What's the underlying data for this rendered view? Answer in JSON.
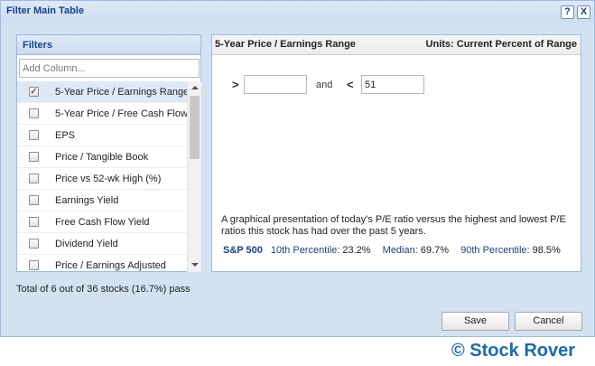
{
  "dialog": {
    "title": "Filter Main Table",
    "help_label": "?",
    "close_label": "X"
  },
  "filters": {
    "header": "Filters",
    "search_placeholder": "Add Column...",
    "items": [
      {
        "label": "5-Year Price / Earnings Range",
        "checked": true
      },
      {
        "label": "5-Year Price / Free Cash Flow",
        "checked": false
      },
      {
        "label": "EPS",
        "checked": false
      },
      {
        "label": "Price / Tangible Book",
        "checked": false
      },
      {
        "label": "Price vs 52-wk High (%)",
        "checked": false
      },
      {
        "label": "Earnings Yield",
        "checked": false
      },
      {
        "label": "Free Cash Flow Yield",
        "checked": false
      },
      {
        "label": "Dividend Yield",
        "checked": false
      },
      {
        "label": "Price / Earnings Adjusted",
        "checked": false
      }
    ]
  },
  "status": "Total of 6 out of 36 stocks (16.7%) pass",
  "detail": {
    "title": "5-Year Price / Earnings Range",
    "units": "Units: Current Percent of Range",
    "greater_than_symbol": ">",
    "less_than_symbol": "<",
    "and_label": "and",
    "min_value": "",
    "max_value": "51",
    "description": "A graphical presentation of today's P/E ratio versus the highest and lowest P/E ratios this stock has had over the past 5 years.",
    "stats": {
      "benchmark": "S&P 500",
      "p10_label": "10th Percentile:",
      "p10_value": "23.2%",
      "median_label": "Median:",
      "median_value": "69.7%",
      "p90_label": "90th Percentile:",
      "p90_value": "98.5%"
    }
  },
  "buttons": {
    "save": "Save",
    "cancel": "Cancel"
  },
  "watermark": "© Stock Rover",
  "colors": {
    "accent": "#15428b",
    "frame": "#d3e1f1",
    "border": "#99bbe8",
    "watermark": "#1a6bb0"
  }
}
